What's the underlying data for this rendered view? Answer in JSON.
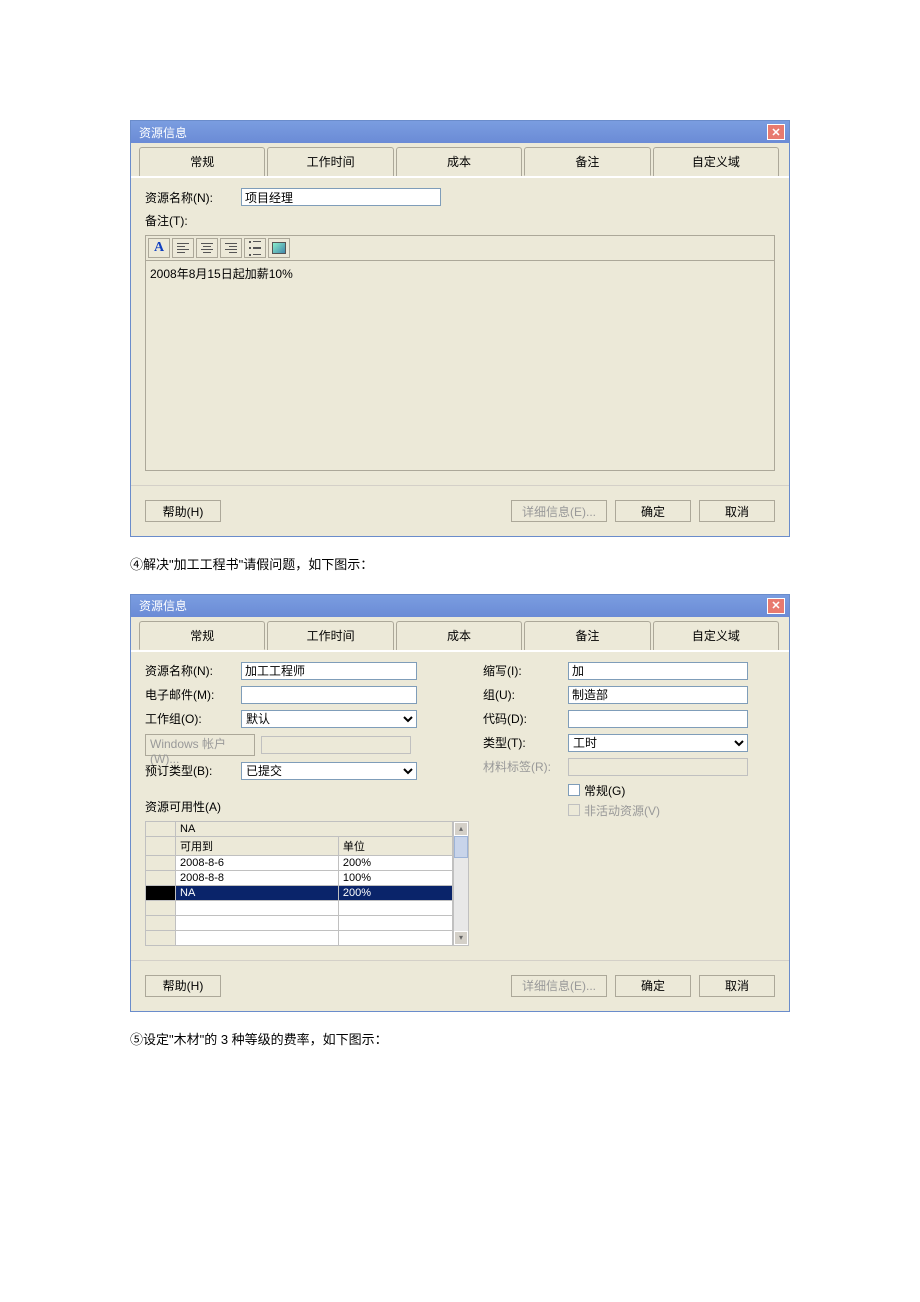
{
  "dialog1": {
    "title": "资源信息",
    "tabs": [
      "常规",
      "工作时间",
      "成本",
      "备注",
      "自定义域"
    ],
    "activeTabIndex": 3,
    "fields": {
      "resourceNameLabel": "资源名称(N):",
      "resourceNameValue": "项目经理",
      "notesLabel": "备注(T):"
    },
    "notesText": "2008年8月15日起加薪10%",
    "buttons": {
      "help": "帮助(H)",
      "details": "详细信息(E)...",
      "ok": "确定",
      "cancel": "取消"
    }
  },
  "caption1": "④解决\"加工工程书\"请假问题，如下图示：",
  "dialog2": {
    "title": "资源信息",
    "tabs": [
      "常规",
      "工作时间",
      "成本",
      "备注",
      "自定义域"
    ],
    "activeTabIndex": 0,
    "leftFields": {
      "resourceNameLabel": "资源名称(N):",
      "resourceNameValue": "加工工程师",
      "emailLabel": "电子邮件(M):",
      "emailValue": "",
      "workgroupLabel": "工作组(O):",
      "workgroupValue": "默认",
      "winAccountLabel": "Windows 帐户(W)...",
      "winAccountValue": "",
      "bookingTypeLabel": "预订类型(B):",
      "bookingTypeValue": "已提交",
      "availabilityLabel": "资源可用性(A)"
    },
    "rightFields": {
      "initialsLabel": "缩写(I):",
      "initialsValue": "加",
      "groupLabel": "组(U):",
      "groupValue": "制造部",
      "codeLabel": "代码(D):",
      "codeValue": "",
      "typeLabel": "类型(T):",
      "typeValue": "工时",
      "materialLabelLabel": "材料标签(R):",
      "genericLabel": "常规(G)",
      "inactiveLabel": "非活动资源(V)"
    },
    "availTable": {
      "topCell": "NA",
      "headers": [
        "可用到",
        "单位"
      ],
      "rows": [
        {
          "date": "2008-8-6",
          "unit": "200%"
        },
        {
          "date": "2008-8-8",
          "unit": "100%"
        },
        {
          "date": "NA",
          "unit": "200%",
          "selected": true
        }
      ]
    },
    "buttons": {
      "help": "帮助(H)",
      "details": "详细信息(E)...",
      "ok": "确定",
      "cancel": "取消"
    }
  },
  "caption2": "⑤设定\"木材\"的 3 种等级的费率，如下图示："
}
